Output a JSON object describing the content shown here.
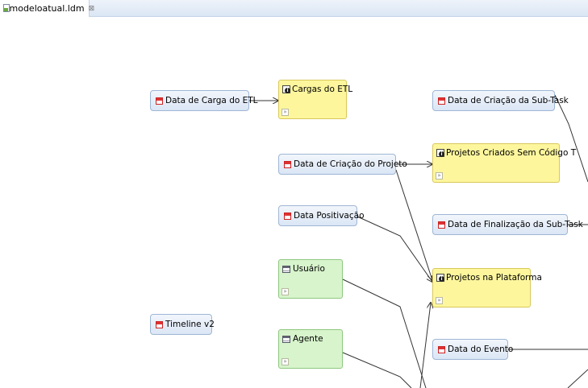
{
  "editor": {
    "tab_title": "*modeloatual.ldm",
    "close_glyph": "⊠"
  },
  "diagram": {
    "dimensions": {
      "data_carga_etl": "Data de Carga do ETL",
      "data_criacao_projeto": "Data de Criação do Projeto",
      "data_positivacao": "Data Positivação",
      "timeline_v2": "Timeline v2",
      "data_criacao_subtask": "Data de Criação da Sub-Task",
      "data_finalizacao_subtask": "Data de Finalização da Sub-Task",
      "data_evento": "Data do Evento"
    },
    "facts": {
      "cargas_etl": "Cargas do ETL",
      "projetos_sem_codigo": "Projetos Criados Sem Código T",
      "projetos_plataforma": "Projetos na Plataforma"
    },
    "attributes": {
      "usuario": "Usuário",
      "agente": "Agente"
    },
    "icons": {
      "date": "calendar-icon",
      "fact": "fact-info-icon",
      "attribute": "table-icon",
      "expand": "expand-chevron-icon"
    },
    "colors": {
      "fact_fill": "#fdf69d",
      "attribute_fill": "#d7f4cc",
      "date_fill": "#dbe6f5",
      "connector": "#333333"
    }
  }
}
